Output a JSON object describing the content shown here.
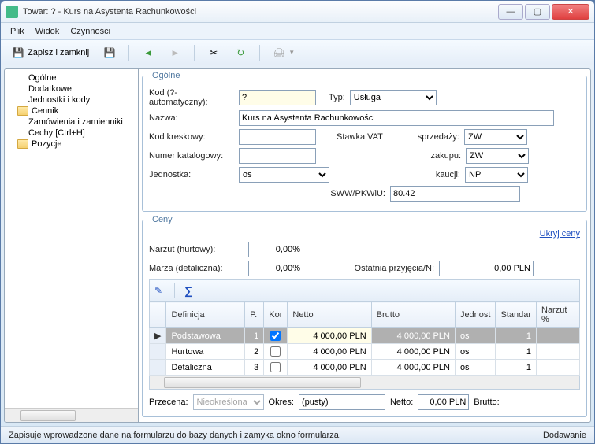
{
  "window": {
    "title": "Towar: ? - Kurs na Asystenta Rachunkowości"
  },
  "menu": {
    "plik": "Plik",
    "widok": "Widok",
    "czynnosci": "Czynności"
  },
  "toolbar": {
    "save_close": "Zapisz i zamknij"
  },
  "sidebar": {
    "items": [
      {
        "label": "Ogólne"
      },
      {
        "label": "Dodatkowe"
      },
      {
        "label": "Jednostki i kody"
      },
      {
        "label": "Cennik",
        "folder": true
      },
      {
        "label": "Zamówienia i zamienniki"
      },
      {
        "label": "Cechy [Ctrl+H]"
      },
      {
        "label": "Pozycje",
        "folder": true
      }
    ]
  },
  "ogolne": {
    "legend": "Ogólne",
    "kod_label": "Kod (?-automatyczny):",
    "kod_value": "?",
    "typ_label": "Typ:",
    "typ_value": "Usługa",
    "nazwa_label": "Nazwa:",
    "nazwa_value": "Kurs na Asystenta Rachunkowości",
    "kod_kreskowy_label": "Kod kreskowy:",
    "kod_kreskowy_value": "",
    "stawka_vat_label": "Stawka VAT",
    "sprzedazy_label": "sprzedaży:",
    "sprzedazy_value": "ZW",
    "numer_kat_label": "Numer katalogowy:",
    "numer_kat_value": "",
    "zakupu_label": "zakupu:",
    "zakupu_value": "ZW",
    "jednostka_label": "Jednostka:",
    "jednostka_value": "os",
    "kaucji_label": "kaucji:",
    "kaucji_value": "NP",
    "sww_label": "SWW/PKWiU:",
    "sww_value": "80.42"
  },
  "ceny": {
    "legend": "Ceny",
    "ukryj": "Ukryj ceny",
    "narzut_label": "Narzut (hurtowy):",
    "narzut_value": "0,00%",
    "marza_label": "Marża (detaliczna):",
    "marza_value": "0,00%",
    "ostatnia_label": "Ostatnia przyjęcia/N:",
    "ostatnia_value": "0,00 PLN",
    "columns": [
      "Definicja",
      "P.",
      "Kor",
      "Netto",
      "Brutto",
      "Jednost",
      "Standar",
      "Narzut %"
    ],
    "rows": [
      {
        "def": "Podstawowa",
        "p": "1",
        "kor": true,
        "netto": "4 000,00 PLN",
        "brutto": "4 000,00 PLN",
        "jedn": "os",
        "std": "1",
        "narzut": ""
      },
      {
        "def": "Hurtowa",
        "p": "2",
        "kor": false,
        "netto": "4 000,00 PLN",
        "brutto": "4 000,00 PLN",
        "jedn": "os",
        "std": "1",
        "narzut": ""
      },
      {
        "def": "Detaliczna",
        "p": "3",
        "kor": false,
        "netto": "4 000,00 PLN",
        "brutto": "4 000,00 PLN",
        "jedn": "os",
        "std": "1",
        "narzut": ""
      }
    ],
    "przecena_label": "Przecena:",
    "przecena_value": "Nieokreślona",
    "okres_label": "Okres:",
    "okres_value": "(pusty)",
    "netto_label": "Netto:",
    "netto_value": "0,00 PLN",
    "brutto_label": "Brutto:"
  },
  "status": {
    "left": "Zapisuje wprowadzone dane na formularzu do bazy danych i zamyka okno formularza.",
    "right": "Dodawanie"
  }
}
